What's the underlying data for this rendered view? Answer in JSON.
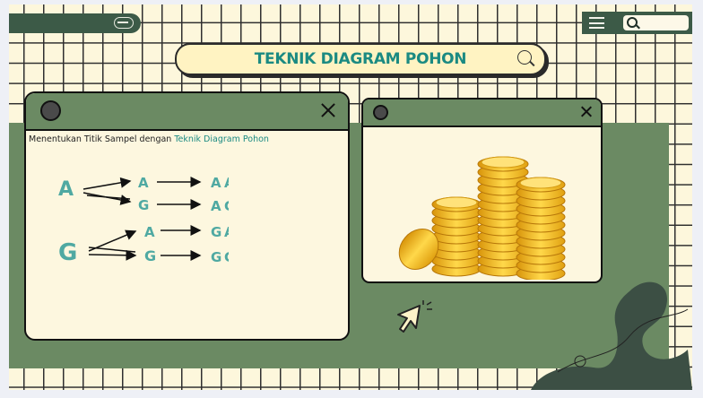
{
  "header": {
    "title": "TEKNIK DIAGRAM POHON"
  },
  "window_text": {
    "subtitle_prefix": "Menentukan Titik Sampel dengan ",
    "subtitle_highlight": "Teknik Diagram Pohon"
  },
  "tree": {
    "roots": [
      "A",
      "G"
    ],
    "branches": [
      {
        "root": "A",
        "child": "A",
        "result": [
          "A",
          "A"
        ]
      },
      {
        "root": "A",
        "child": "G",
        "result": [
          "A",
          "G"
        ]
      },
      {
        "root": "G",
        "child": "A",
        "result": [
          "G",
          "A"
        ]
      },
      {
        "root": "G",
        "child": "G",
        "result": [
          "G",
          "G"
        ]
      }
    ]
  },
  "icons": [
    "toggle-icon",
    "menu-icon",
    "search-icon",
    "close-icon",
    "cursor-icon",
    "coins-image"
  ],
  "colors": {
    "cream": "#fdf7dc",
    "green": "#6b8a63",
    "dark_green": "#3c5a47",
    "teal": "#1b8a82",
    "letter_teal": "#4fa9a2"
  }
}
